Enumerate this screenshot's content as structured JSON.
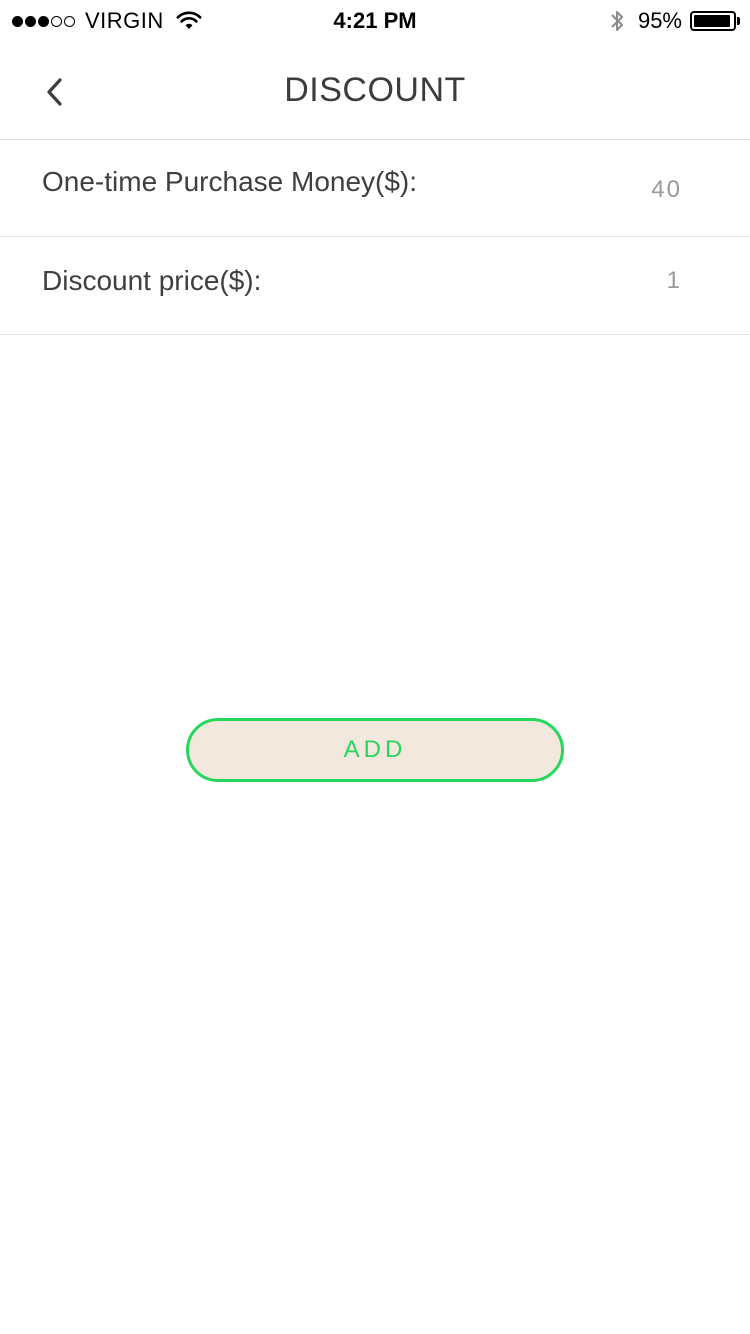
{
  "status_bar": {
    "carrier": "VIRGIN",
    "time": "4:21 PM",
    "battery_percent": "95%",
    "battery_level": 0.95,
    "signal_strength": {
      "filled": 3,
      "total": 5
    }
  },
  "nav": {
    "title": "DISCOUNT",
    "back_icon": "chevron-left-icon"
  },
  "form": {
    "rows": [
      {
        "label": "One-time Purchase Money($):",
        "value": "40"
      },
      {
        "label": "Discount price($):",
        "value": "1"
      }
    ]
  },
  "actions": {
    "add_label": "ADD"
  },
  "colors": {
    "accent": "#27d65c",
    "button_bg": "#f2e8dd",
    "value_text": "#9a9a9a",
    "label_text": "#3f3f3f"
  }
}
